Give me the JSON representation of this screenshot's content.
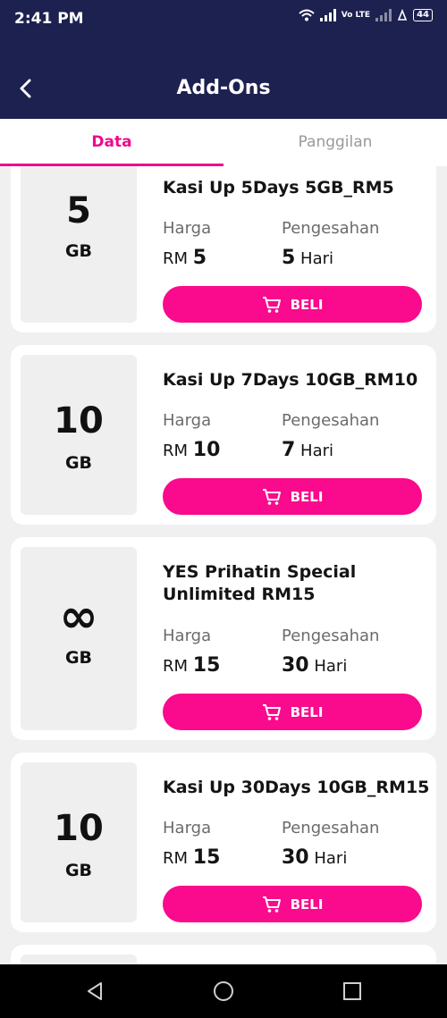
{
  "status_bar": {
    "time": "2:41 PM",
    "volte": "Vo LTE",
    "battery": "44"
  },
  "header": {
    "title": "Add-Ons"
  },
  "tabs": [
    {
      "label": "Data"
    },
    {
      "label": "Panggilan"
    }
  ],
  "card_labels": {
    "price": "Harga",
    "validity": "Pengesahan",
    "currency": "RM",
    "day_unit": "Hari",
    "buy": "BELI"
  },
  "plans": [
    {
      "quota": "5",
      "unit": "GB",
      "name": "Kasi Up 5Days 5GB_RM5",
      "price": "5",
      "validity": "5"
    },
    {
      "quota": "10",
      "unit": "GB",
      "name": "Kasi Up 7Days 10GB_RM10",
      "price": "10",
      "validity": "7"
    },
    {
      "quota": "∞",
      "unit": "GB",
      "name": "YES Prihatin Special Unlimited RM15",
      "price": "15",
      "validity": "30"
    },
    {
      "quota": "10",
      "unit": "GB",
      "name": "Kasi Up 30Days 10GB_RM15",
      "price": "15",
      "validity": "30"
    }
  ],
  "colors": {
    "header_bg": "#1d2150",
    "accent": "#ec0a8c",
    "button": "#fa0a8c"
  }
}
